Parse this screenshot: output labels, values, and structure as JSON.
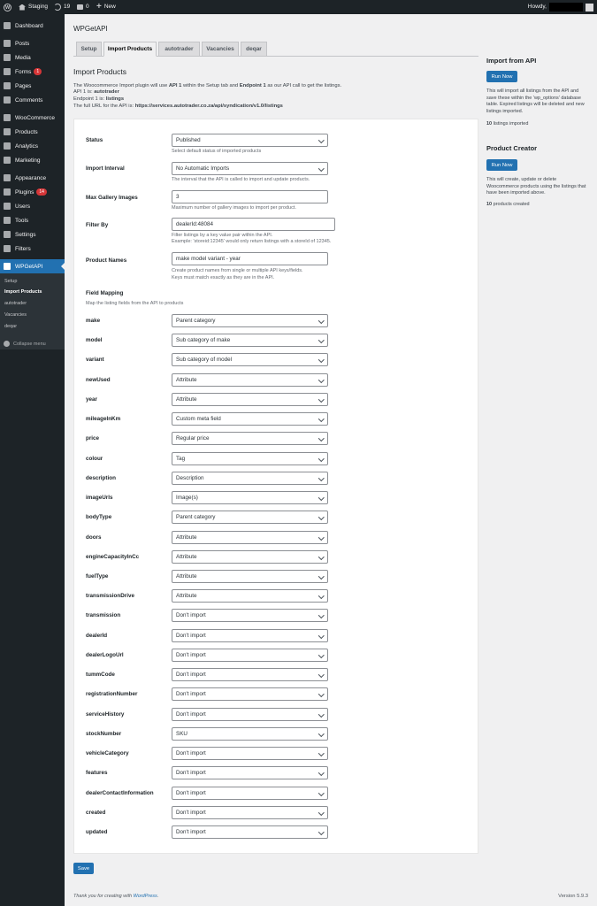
{
  "adminbar": {
    "site_name": "Staging",
    "updates_count": "19",
    "comments_count": "0",
    "new_label": "New",
    "howdy": "Howdy,"
  },
  "sidebar": {
    "items": [
      {
        "label": "Dashboard",
        "icon": "dashboard-icon"
      },
      {
        "label": "Posts",
        "icon": "pin-icon"
      },
      {
        "label": "Media",
        "icon": "media-icon"
      },
      {
        "label": "Forms",
        "icon": "forms-icon",
        "badge": "1"
      },
      {
        "label": "Pages",
        "icon": "page-icon"
      },
      {
        "label": "Comments",
        "icon": "comment-icon"
      },
      {
        "label": "WooCommerce",
        "icon": "woocommerce-icon"
      },
      {
        "label": "Products",
        "icon": "products-icon"
      },
      {
        "label": "Analytics",
        "icon": "analytics-icon"
      },
      {
        "label": "Marketing",
        "icon": "megaphone-icon"
      },
      {
        "label": "Appearance",
        "icon": "brush-icon"
      },
      {
        "label": "Plugins",
        "icon": "plugin-icon",
        "badge": "14"
      },
      {
        "label": "Users",
        "icon": "users-icon"
      },
      {
        "label": "Tools",
        "icon": "wrench-icon"
      },
      {
        "label": "Settings",
        "icon": "settings-icon"
      },
      {
        "label": "Filters",
        "icon": "filter-icon"
      },
      {
        "label": "WPGetAPI",
        "icon": "code-icon"
      }
    ],
    "submenu": [
      "Setup",
      "Import Products",
      "autotrader",
      "Vacancies",
      "deqar"
    ],
    "collapse_label": "Collapse menu"
  },
  "page": {
    "title": "WPGetAPI",
    "tabs": [
      "Setup",
      "Import Products",
      "autotrader",
      "Vacancies",
      "deqar"
    ],
    "heading": "Import Products",
    "intro": {
      "line1_a": "The Woocommerce Import plugin will use ",
      "line1_b": "API 1",
      "line1_c": " within the Setup tab and ",
      "line1_d": "Endpoint 1",
      "line1_e": " as our API call to get the listings.",
      "line2_a": "API 1 is: ",
      "line2_b": "autotrader",
      "line3_a": "Endpoint 1 is: ",
      "line3_b": "listings",
      "line4_a": "The full URL for the API is: ",
      "line4_b": "https://services.autotrader.co.za/api/syndication/v1.0/listings"
    },
    "settings": {
      "status": {
        "label": "Status",
        "value": "Published",
        "desc": "Select default status of imported products"
      },
      "interval": {
        "label": "Import Interval",
        "value": "No Automatic Imports",
        "desc": "The interval that the API is called to import and update products."
      },
      "gallery": {
        "label": "Max Gallery Images",
        "value": "3",
        "desc": "Maximum number of gallery images to import per product."
      },
      "filter": {
        "label": "Filter By",
        "value": "dealerId:48084",
        "desc1": "Filter listings by a key value pair within the API.",
        "desc2": "Example: 'storeid:12345' would only return listings with a storeId of 12345."
      },
      "names": {
        "label": "Product Names",
        "value": "make model variant - year",
        "desc1": "Create product names from single or multiple API keys/fields.",
        "desc2": "Keys must match exactly as they are in the API."
      }
    },
    "field_mapping_title": "Field Mapping",
    "field_mapping_desc": "Map the listing fields from the API to products",
    "fields": [
      {
        "name": "make",
        "value": "Parent category"
      },
      {
        "name": "model",
        "value": "Sub category of make"
      },
      {
        "name": "variant",
        "value": "Sub category of model"
      },
      {
        "name": "newUsed",
        "value": "Attribute"
      },
      {
        "name": "year",
        "value": "Attribute"
      },
      {
        "name": "mileageInKm",
        "value": "Custom meta field"
      },
      {
        "name": "price",
        "value": "Regular price"
      },
      {
        "name": "colour",
        "value": "Tag"
      },
      {
        "name": "description",
        "value": "Description"
      },
      {
        "name": "imageUrls",
        "value": "Image(s)"
      },
      {
        "name": "bodyType",
        "value": "Parent category"
      },
      {
        "name": "doors",
        "value": "Attribute"
      },
      {
        "name": "engineCapacityInCc",
        "value": "Attribute"
      },
      {
        "name": "fuelType",
        "value": "Attribute"
      },
      {
        "name": "transmissionDrive",
        "value": "Attribute"
      },
      {
        "name": "transmission",
        "value": "Don't import"
      },
      {
        "name": "dealerId",
        "value": "Don't import"
      },
      {
        "name": "dealerLogoUrl",
        "value": "Don't import"
      },
      {
        "name": "tummCode",
        "value": "Don't import"
      },
      {
        "name": "registrationNumber",
        "value": "Don't import"
      },
      {
        "name": "serviceHistory",
        "value": "Don't import"
      },
      {
        "name": "stockNumber",
        "value": "SKU"
      },
      {
        "name": "vehicleCategory",
        "value": "Don't import"
      },
      {
        "name": "features",
        "value": "Don't import"
      },
      {
        "name": "dealerContactInformation",
        "value": "Don't import"
      },
      {
        "name": "created",
        "value": "Don't import"
      },
      {
        "name": "updated",
        "value": "Don't import"
      }
    ],
    "save_label": "Save"
  },
  "side": {
    "import": {
      "title": "Import from API",
      "button": "Run Now",
      "desc": "This will import all listings from the API and save these within the 'wp_options' database table. Expired listings will be deleted and new listings imported.",
      "count_num": "10",
      "count_text": " listings imported"
    },
    "creator": {
      "title": "Product Creator",
      "button": "Run Now",
      "desc": "This will create, update or delete Woocommerce products using the listings that have been imported above.",
      "count_num": "10",
      "count_text": " products created"
    }
  },
  "footer": {
    "thanks_a": "Thank you for creating with ",
    "thanks_link": "WordPress",
    "thanks_b": ".",
    "version": "Version 5.9.3"
  }
}
